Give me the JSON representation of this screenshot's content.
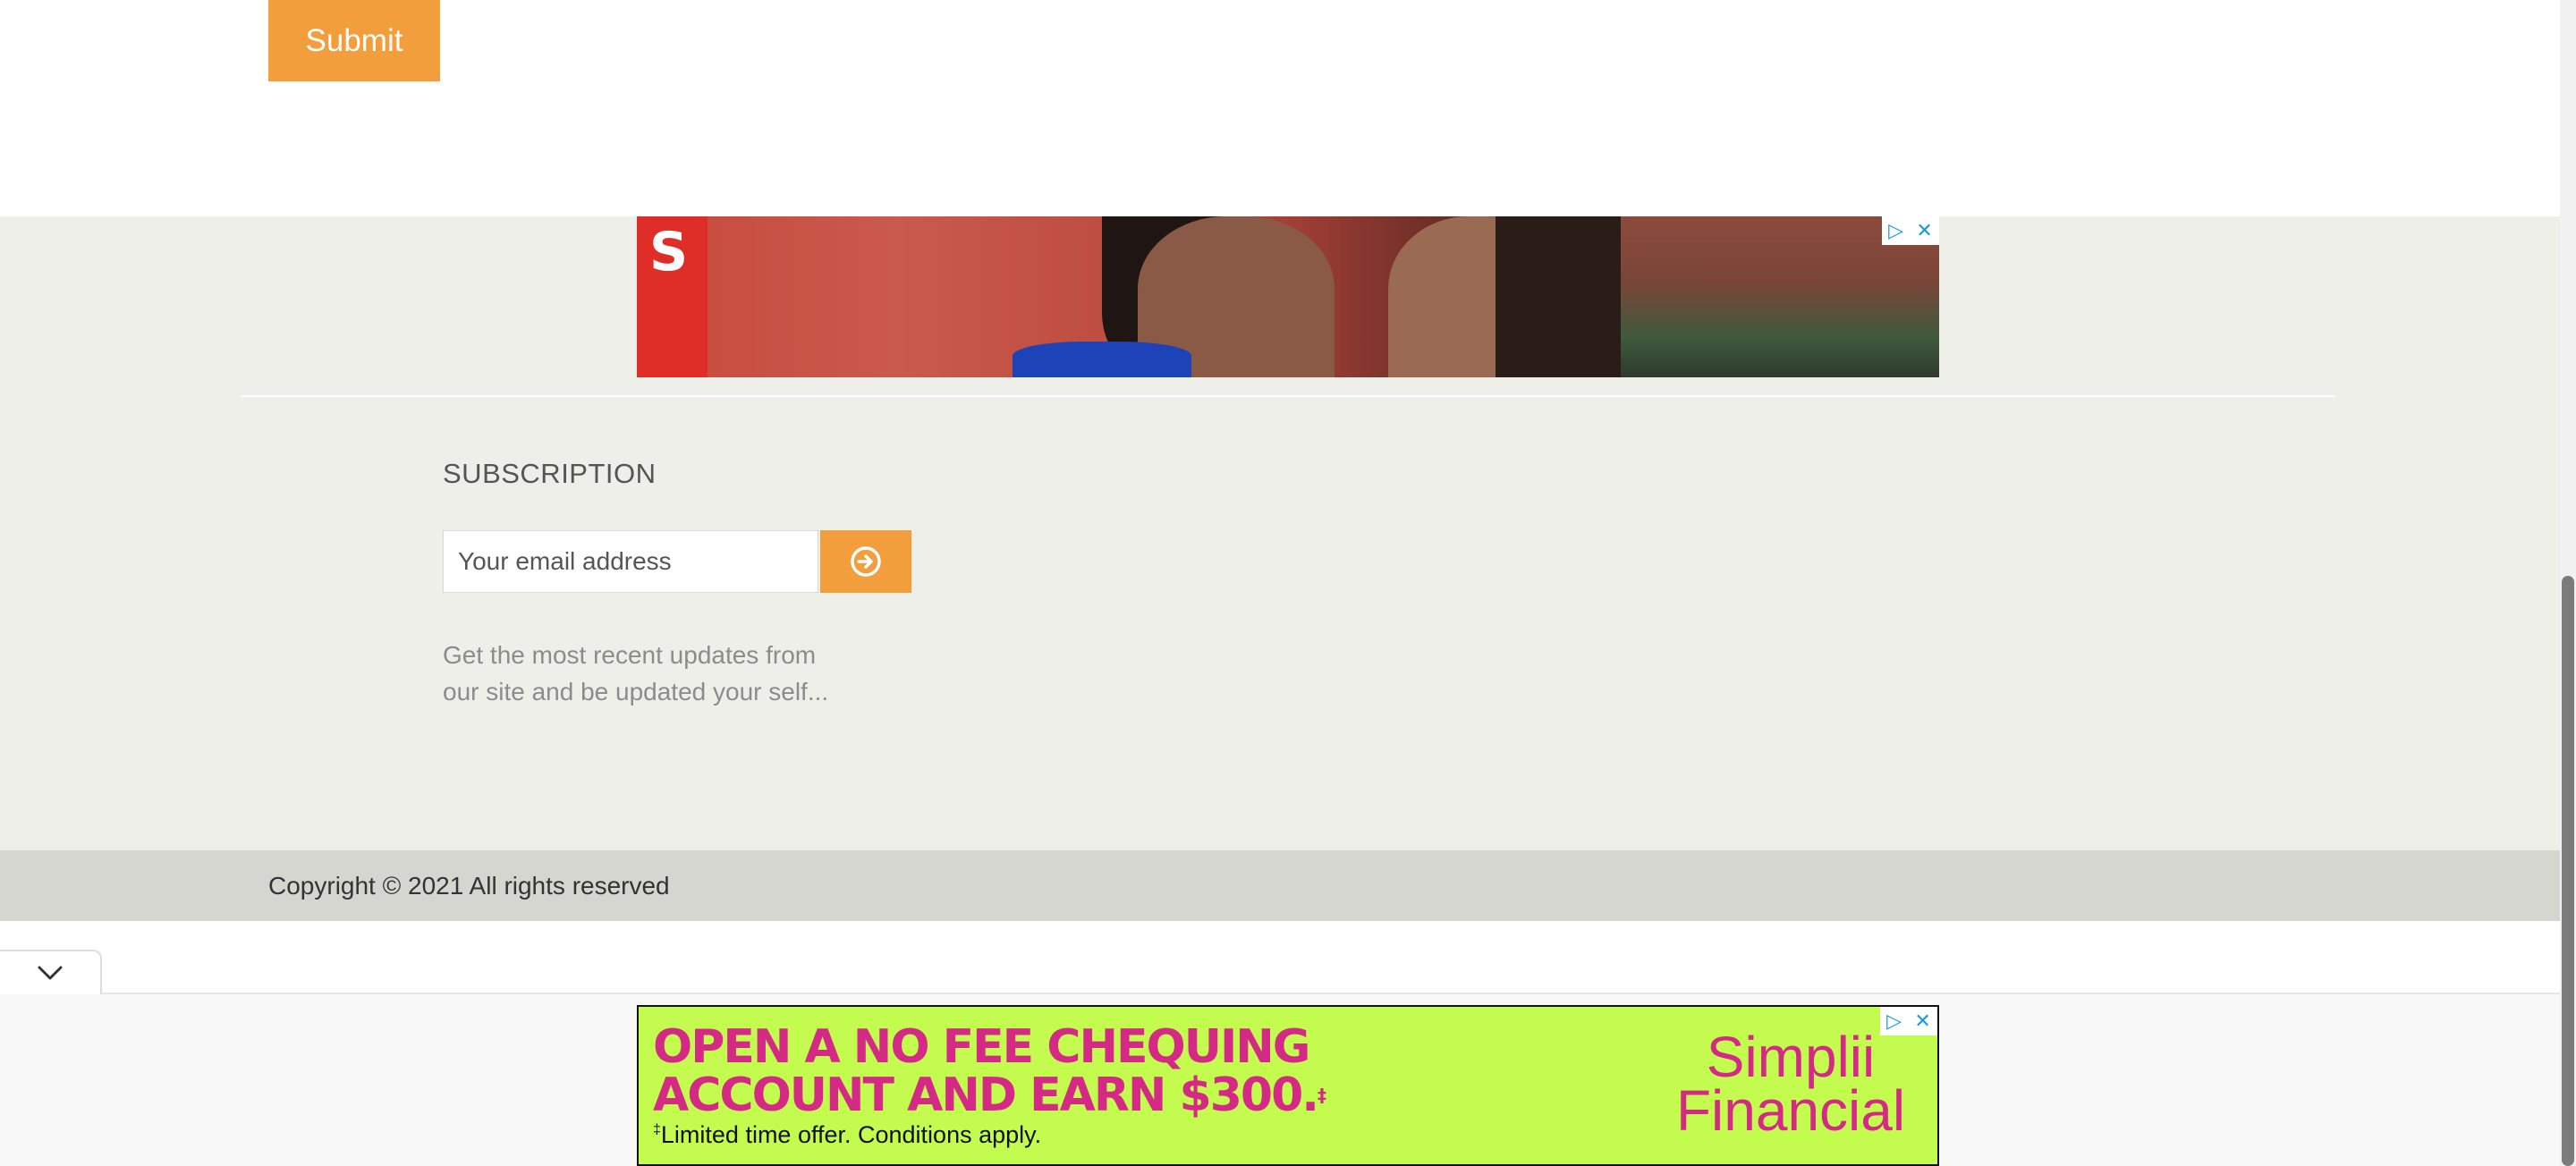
{
  "form": {
    "submit_label": "Submit"
  },
  "top_ad": {
    "badge_play": "▷",
    "badge_close": "✕",
    "logo_letter": "S"
  },
  "subscription": {
    "title": "SUBSCRIPTION",
    "email_placeholder": "Your email address",
    "description_line1": "Get the most recent updates from",
    "description_line2": "our site and be updated your self..."
  },
  "footer": {
    "copyright": "Copyright © 2021 All rights reserved"
  },
  "bottom_ad": {
    "headline_line1": "OPEN A NO FEE CHEQUING",
    "headline_line2": "ACCOUNT AND EARN $300.",
    "headline_mark": "‡",
    "fine_print_mark": "‡",
    "fine_print": "Limited time offer. Conditions apply.",
    "brand_line1": "Simplii",
    "brand_line2": "Financial",
    "badge_play": "▷",
    "badge_close": "✕"
  },
  "colors": {
    "accent": "#f29e3d",
    "footer_bg": "#efefe9",
    "copyright_bg": "#d5d6d0",
    "ad_green": "#c4fb4f",
    "ad_pink": "#d42a86",
    "brand_red": "#df2e27"
  },
  "icons": {
    "go_button": "arrow-circle-right-icon",
    "collapse_tab": "chevron-down-icon",
    "ad_choices": "adchoices-icon",
    "ad_close": "close-icon"
  }
}
